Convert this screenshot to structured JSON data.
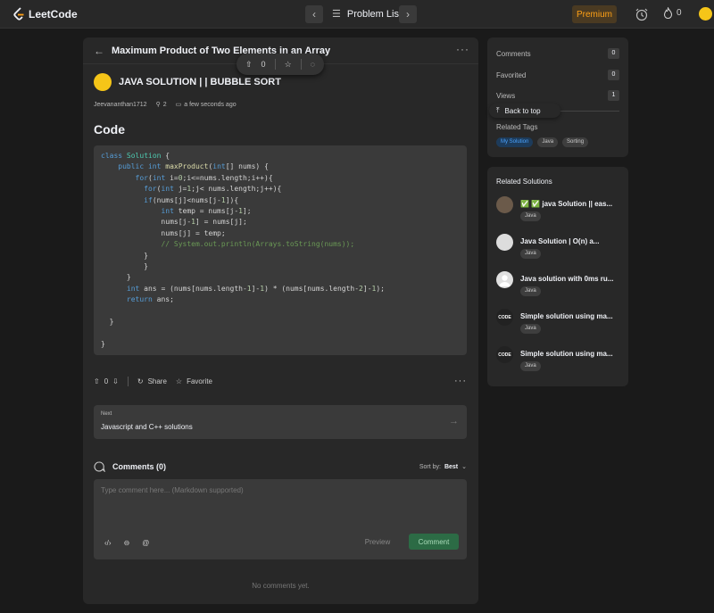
{
  "nav": {
    "brand": "LeetCode",
    "problem_list": "Problem List",
    "premium": "Premium",
    "streak": "0"
  },
  "main": {
    "title": "Maximum Product of Two Elements in an Array",
    "float_votes": "0",
    "solution_title": "JAVA SOLUTION | | BUBBLE SORT",
    "author": "Jeevananthan1712",
    "views": "2",
    "posted": "a few seconds ago",
    "code_heading": "Code",
    "votes": "0",
    "share": "Share",
    "favorite": "Favorite",
    "next_label": "Next",
    "next_title": "Javascript and C++ solutions",
    "comments_title": "Comments (0)",
    "sort_label": "Sort by:",
    "sort_value": "Best",
    "comment_placeholder": "Type comment here... (Markdown supported)",
    "preview": "Preview",
    "comment_btn": "Comment",
    "no_comments": "No comments yet."
  },
  "stats": {
    "comments_label": "Comments",
    "comments_value": "0",
    "favorited_label": "Favorited",
    "favorited_value": "0",
    "views_label": "Views",
    "views_value": "1",
    "back_to_top": "Back to top",
    "related_tags": "Related Tags",
    "tags": [
      "My Solution",
      "Java",
      "Sorting"
    ]
  },
  "related": {
    "title": "Related Solutions",
    "items": [
      {
        "title": "✅ ✅ java Solution || eas...",
        "tag": "Java"
      },
      {
        "title": "Java Solution | O(n) a...",
        "tag": "Java"
      },
      {
        "title": "Java solution with 0ms ru...",
        "tag": "Java"
      },
      {
        "title": "Simple solution using ma...",
        "tag": "Java"
      },
      {
        "title": "Simple solution using ma...",
        "tag": "Java"
      }
    ]
  },
  "colors": {
    "background": "#1a1a1a",
    "panel": "#282828",
    "accent_premium": "#ffa116",
    "comment_button": "#2c6b45",
    "active_tag": "#4aa3ff"
  }
}
